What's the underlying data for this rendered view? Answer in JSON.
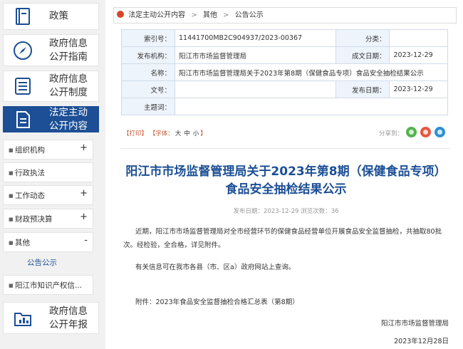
{
  "sidebar": {
    "items": [
      {
        "label": "政策",
        "icon": "policy-book-icon"
      },
      {
        "label": "政府信息\n公开指南",
        "icon": "compass-icon"
      },
      {
        "label": "政府信息\n公开制度",
        "icon": "document-list-icon"
      },
      {
        "label": "法定主动\n公开内容",
        "icon": "file-icon"
      },
      {
        "label": "政府信息\n公开年报",
        "icon": "folder-chart-icon"
      }
    ],
    "sub_items": [
      {
        "label": "组织机构",
        "toggle": "+"
      },
      {
        "label": "行政执法",
        "toggle": ""
      },
      {
        "label": "工作动态",
        "toggle": "+"
      },
      {
        "label": "财政预决算",
        "toggle": "+"
      },
      {
        "label": "其他",
        "toggle": "-"
      },
      {
        "label": "阳江市知识产权信...",
        "toggle": ""
      }
    ],
    "active_child": "公告公示",
    "active_color": "#1c4f95"
  },
  "breadcrumb": [
    "法定主动公开内容",
    "其他",
    "公告公示"
  ],
  "info": {
    "index_label": "索引号：",
    "index_value": "11441700MB2C904937/2023-00367",
    "category_label": "分类：",
    "category_value": "",
    "publisher_label": "发布机构：",
    "publisher_value": "阳江市市场监督管理局",
    "created_label": "成文日期：",
    "created_value": "2023-12-29",
    "name_label": "名称：",
    "name_value": "阳江市市场监督管理局关于2023年第8期（保健食品专项）食品安全抽检结果公示",
    "docno_label": "文号：",
    "docno_value": "",
    "published_label": "发布日期：",
    "published_value": "2023-12-29",
    "keywords_label": "主题词：",
    "keywords_value": ""
  },
  "tools": {
    "print": "【打印】",
    "font_prefix": "【字体：",
    "sizes": [
      "大",
      "中",
      "小"
    ],
    "font_suffix": "】",
    "share_label": "分享到："
  },
  "article": {
    "title": "阳江市市场监督管理局关于2023年第8期（保健食品专项）食品安全抽检结果公示",
    "meta": "发布日期：2023-12-29  浏览次数：36",
    "p1": "近期，阳江市市场监督管理局对全市经营环节的保健食品经营单位开展食品安全监督抽检，共抽取80批次。经检验，全合格，详见附件。",
    "p2": "有关信息可在我市各县（市、区a）政府网站上查询。",
    "p3": "附件：2023年食品安全监督抽检合格汇总表（第8期）",
    "signature": "阳江市市场监督管理局",
    "date": "2023年12月28日"
  }
}
